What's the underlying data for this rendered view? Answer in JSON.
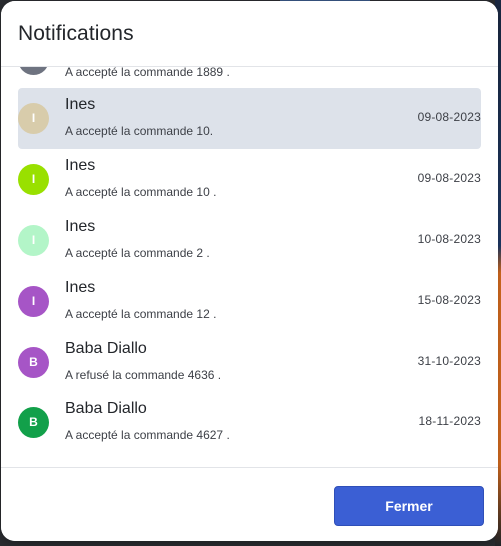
{
  "dialog": {
    "title": "Notifications",
    "close_label": "Fermer",
    "accent_color": "#3b5fd4",
    "selected_row_color": "#dde2ea"
  },
  "notifications": [
    {
      "initial": "",
      "name": "",
      "message": "A accepté la commande 1889 .",
      "date": "",
      "avatar_color": "#6e7380",
      "partial": true
    },
    {
      "initial": "I",
      "name": "Ines",
      "message": "A accepté la commande 10.",
      "date": "09-08-2023",
      "avatar_color": "#d8ccab",
      "selected": true
    },
    {
      "initial": "I",
      "name": "Ines",
      "message": "A accepté la commande 10 .",
      "date": "09-08-2023",
      "avatar_color": "#99e000"
    },
    {
      "initial": "I",
      "name": "Ines",
      "message": "A accepté la commande 2 .",
      "date": "10-08-2023",
      "avatar_color": "#b3f5c8"
    },
    {
      "initial": "I",
      "name": "Ines",
      "message": "A accepté la commande 12 .",
      "date": "15-08-2023",
      "avatar_color": "#a655c6"
    },
    {
      "initial": "B",
      "name": "Baba Diallo",
      "message": "A refusé la commande 4636 .",
      "date": "31-10-2023",
      "avatar_color": "#a655c6"
    },
    {
      "initial": "B",
      "name": "Baba Diallo",
      "message": "A accepté la commande 4627 .",
      "date": "18-11-2023",
      "avatar_color": "#12a04a"
    }
  ]
}
